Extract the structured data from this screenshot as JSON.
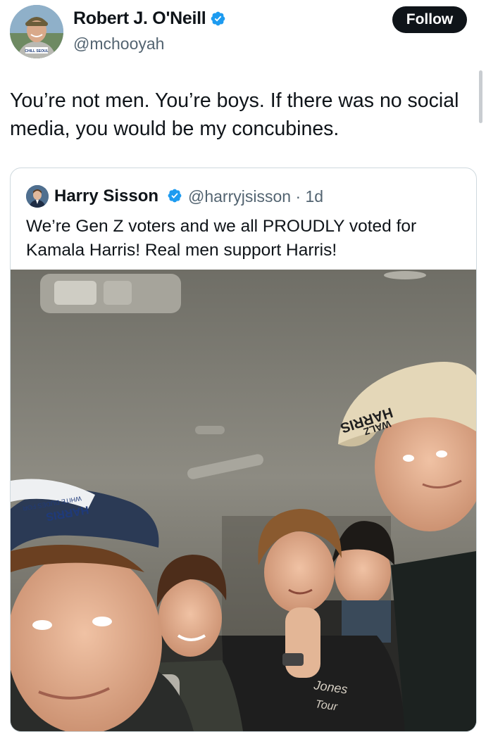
{
  "author": {
    "display_name": "Robert J. O'Neill",
    "handle": "@mchooyah",
    "avatar_hat_text": "CHILL SEOUL"
  },
  "follow_label": "Follow",
  "tweet_text": "You’re not men. You’re boys. If there was no social media, you would be my concubines.",
  "quoted": {
    "display_name": "Harry Sisson",
    "handle_and_time": "@harryjsisson · 1d",
    "text": "We’re Gen Z voters and we all PROUDLY voted for Kamala Harris! Real men support Harris!",
    "media": {
      "cap_right_text": [
        "HARRIS",
        "WALZ"
      ],
      "cap_left_text": [
        "WHITE DUDES FOR",
        "HARRIS"
      ],
      "shirt_text": [
        "Jones",
        "Tour"
      ]
    }
  },
  "colors": {
    "verified": "#1d9bf0",
    "text": "#0f1419",
    "secondary": "#536471",
    "border": "#cfd9de"
  },
  "icons": [
    "verified-badge-icon"
  ]
}
